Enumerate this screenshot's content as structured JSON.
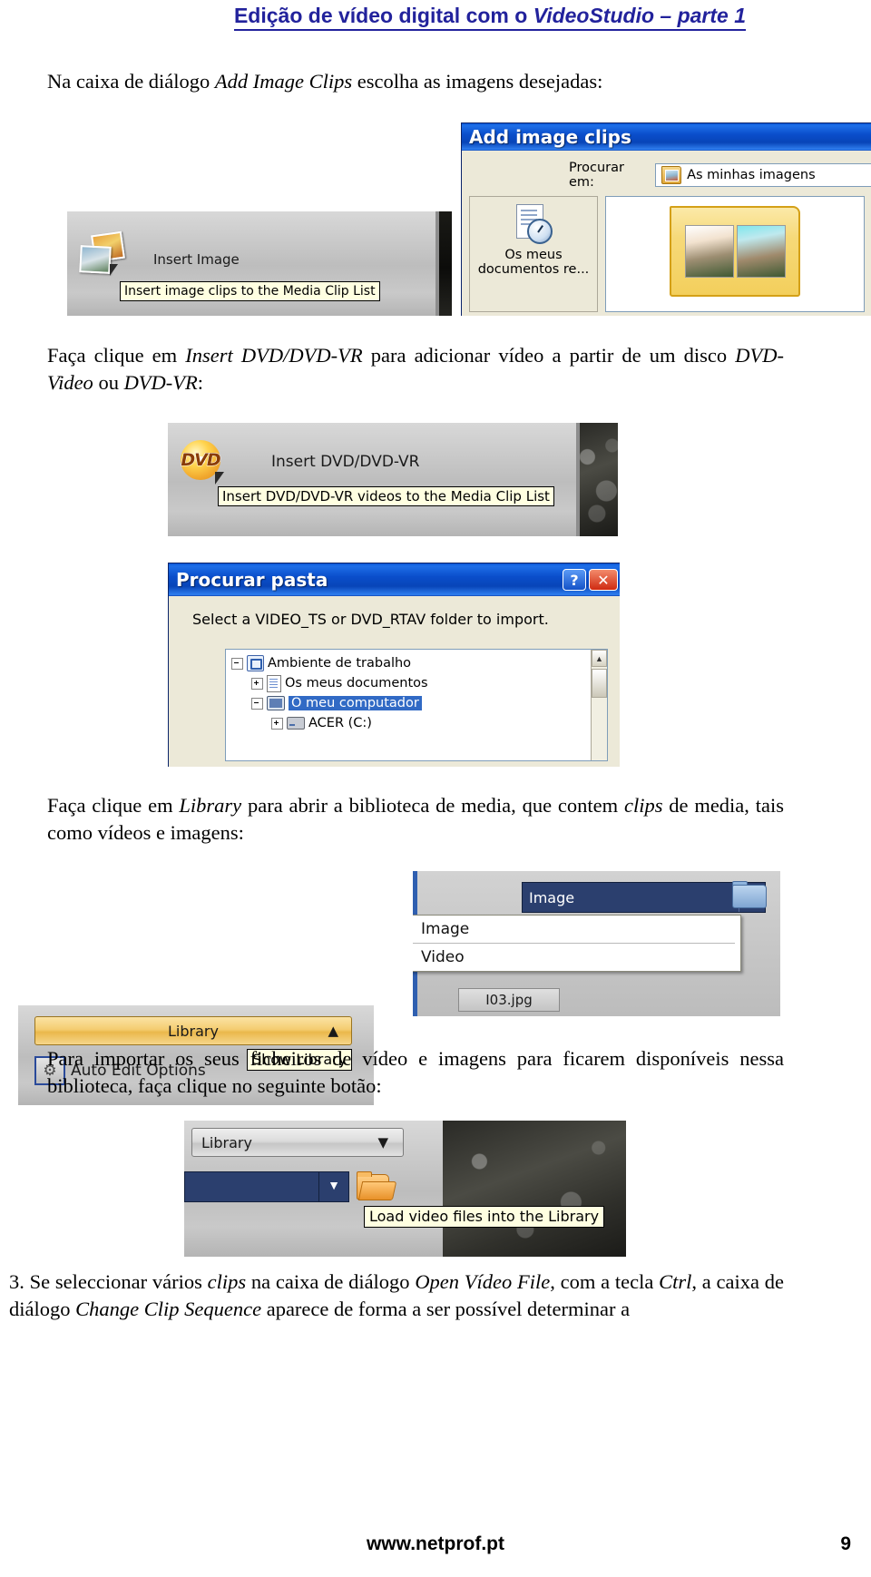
{
  "header": {
    "title_plain": "Edição de vídeo digital com o ",
    "title_italic": "VideoStudio – parte 1"
  },
  "paragraphs": {
    "p1_a": "Na caixa de diálogo ",
    "p1_i": "Add Image Clips",
    "p1_b": " escolha as imagens desejadas:",
    "p2_a": "Faça clique em ",
    "p2_i1": "Insert DVD/DVD-VR",
    "p2_b": " para adicionar vídeo a partir de um disco ",
    "p2_i2": "DVD-Video",
    "p2_c": " ou ",
    "p2_i3": "DVD-VR",
    "p2_d": ":",
    "p3_a": "Faça clique em ",
    "p3_i1": "Library",
    "p3_b": " para abrir a biblioteca de media, que contem ",
    "p3_i2": "clips",
    "p3_c": " de media, tais como vídeos e imagens:",
    "p4": "Para importar os seus ficheiros de vídeo e imagens para ficarem disponíveis nessa biblioteca, faça clique no seguinte botão:",
    "p5_a": "3. Se seleccionar vários ",
    "p5_i1": "clips",
    "p5_b": " na caixa de diálogo ",
    "p5_i2": "Open Vídeo File",
    "p5_c": ", com a tecla ",
    "p5_i3": "Ctrl",
    "p5_d": ", a caixa de diálogo ",
    "p5_i4": "Change Clip Sequence",
    "p5_e": " aparece de forma a ser possível determinar a"
  },
  "shot_insert_image": {
    "button_label": "Insert Image",
    "tooltip": "Insert image clips to the Media Clip List",
    "photos_icon": "photos-icon"
  },
  "shot_add_image_clips": {
    "title": "Add image clips",
    "lookin_label": "Procurar em:",
    "lookin_value": "As minhas imagens",
    "places": [
      {
        "label_line1": "Os meus",
        "label_line2": "documentos re..."
      }
    ],
    "folder_thumb_name": "image-folder-thumbnail"
  },
  "shot_insert_dvd": {
    "disc_text": "DVD",
    "button_label": "Insert DVD/DVD-VR",
    "tooltip": "Insert DVD/DVD-VR videos to the Media Clip List"
  },
  "shot_procurar_pasta": {
    "title": "Procurar pasta",
    "help_button": "?",
    "close_button": "✕",
    "instruction": "Select a VIDEO_TS or DVD_RTAV folder to import.",
    "tree": [
      {
        "label": "Ambiente de trabalho",
        "indent": 0,
        "expander": "minus",
        "icon": "desktop-icon",
        "selected": false
      },
      {
        "label": "Os meus documentos",
        "indent": 1,
        "expander": "plus",
        "icon": "documents-icon",
        "selected": false
      },
      {
        "label": "O meu computador",
        "indent": 1,
        "expander": "minus",
        "icon": "computer-icon",
        "selected": true
      },
      {
        "label": "ACER (C:)",
        "indent": 2,
        "expander": "plus",
        "icon": "drive-icon",
        "selected": false
      }
    ]
  },
  "shot_library_panel": {
    "library_button": "Library",
    "library_chevron": "⌃⌃",
    "auto_edit_label": "Auto Edit Options",
    "tooltip": "Show Library",
    "combo_value": "Image",
    "dropdown_options": [
      "Image",
      "Video"
    ],
    "file_label": "I03.jpg"
  },
  "shot_load_library": {
    "library_button": "Library",
    "library_chevron": "⌄⌄",
    "tooltip": "Load video files into the Library",
    "folder_icon": "open-folder-icon"
  },
  "footer": {
    "url": "www.netprof.pt",
    "page_number": "9"
  },
  "colors": {
    "header_blue": "#22229c",
    "xp_title_blue": "#0a56d6",
    "selection_blue": "#316ac5",
    "library_orange": "#f4cd71",
    "navy_combo": "#2b3f6e",
    "tooltip_yellow": "#ffffe1"
  }
}
